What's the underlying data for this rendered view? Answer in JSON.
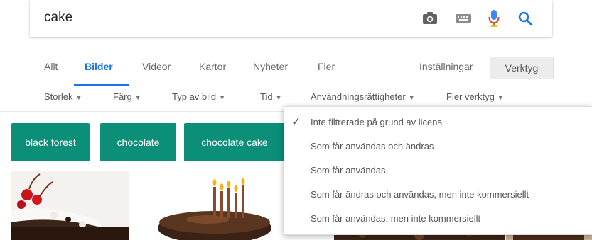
{
  "search": {
    "query": "cake"
  },
  "tabs": [
    {
      "label": "Allt"
    },
    {
      "label": "Bilder"
    },
    {
      "label": "Videor"
    },
    {
      "label": "Kartor"
    },
    {
      "label": "Nyheter"
    },
    {
      "label": "Fler"
    }
  ],
  "settings_label": "Inställningar",
  "tools_label": "Verktyg",
  "filters": [
    {
      "label": "Storlek"
    },
    {
      "label": "Färg"
    },
    {
      "label": "Typ av bild"
    },
    {
      "label": "Tid"
    },
    {
      "label": "Användningsrättigheter"
    },
    {
      "label": "Fler verktyg"
    }
  ],
  "chips": [
    {
      "label": "black forest"
    },
    {
      "label": "chocolate"
    },
    {
      "label": "chocolate cake"
    }
  ],
  "usage_rights_menu": [
    {
      "label": "Inte filtrerade på grund av licens",
      "selected": true
    },
    {
      "label": "Som får användas och ändras"
    },
    {
      "label": "Som får användas"
    },
    {
      "label": "Som får ändras och användas, men inte kommersiellt"
    },
    {
      "label": "Som får användas, men inte kommersiellt"
    }
  ],
  "colors": {
    "accent": "#1a73e8",
    "chip": "#0b8f79"
  }
}
